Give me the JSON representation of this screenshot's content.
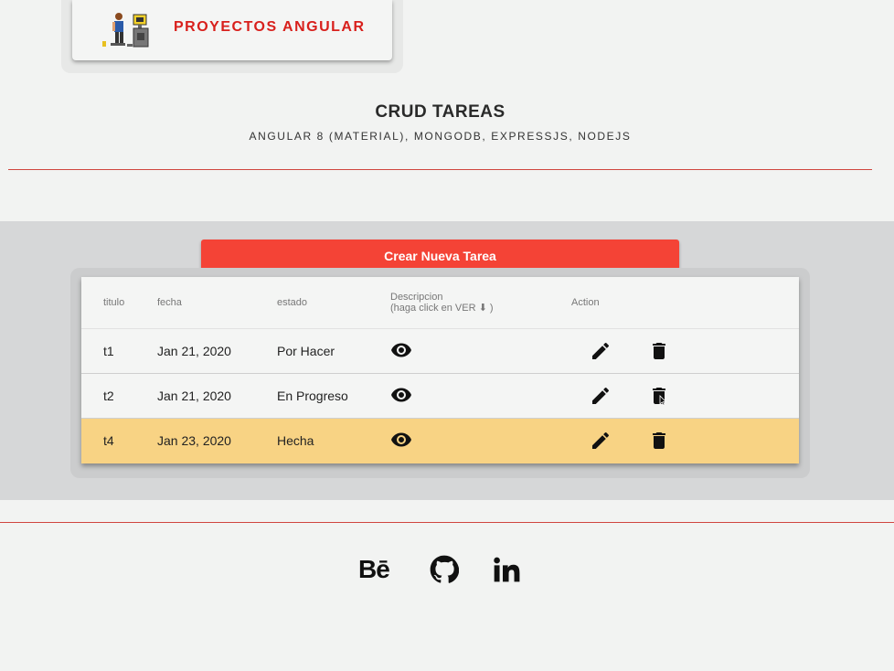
{
  "header": {
    "logo_text": "PROYECTOS ANGULAR",
    "title": "CRUD TAREAS",
    "subtitle": "ANGULAR 8 (MATERIAL), MONGODB, EXPRESSJS, NODEJS"
  },
  "actions": {
    "create_label": "Crear Nueva Tarea"
  },
  "table": {
    "columns": {
      "titulo": "titulo",
      "fecha": "fecha",
      "estado": "estado",
      "descripcion": "Descripcion",
      "descripcion_hint": "(haga click en VER ⬇ )",
      "action": "Action"
    },
    "rows": [
      {
        "titulo": "t1",
        "fecha": "Jan 21, 2020",
        "estado": "Por Hacer"
      },
      {
        "titulo": "t2",
        "fecha": "Jan 21, 2020",
        "estado": "En Progreso"
      },
      {
        "titulo": "t4",
        "fecha": "Jan 23, 2020",
        "estado": "Hecha"
      }
    ],
    "icons": {
      "view": "eye-icon",
      "edit": "pencil-icon",
      "delete": "trash-icon"
    }
  },
  "footer": {
    "behance_label": "Bē",
    "icons": [
      "behance-icon",
      "github-icon",
      "linkedin-icon"
    ]
  },
  "colors": {
    "accent": "#f44336",
    "brand_text": "#d8201c",
    "highlight_row": "#f8d384",
    "band": "#d6d7d8"
  }
}
